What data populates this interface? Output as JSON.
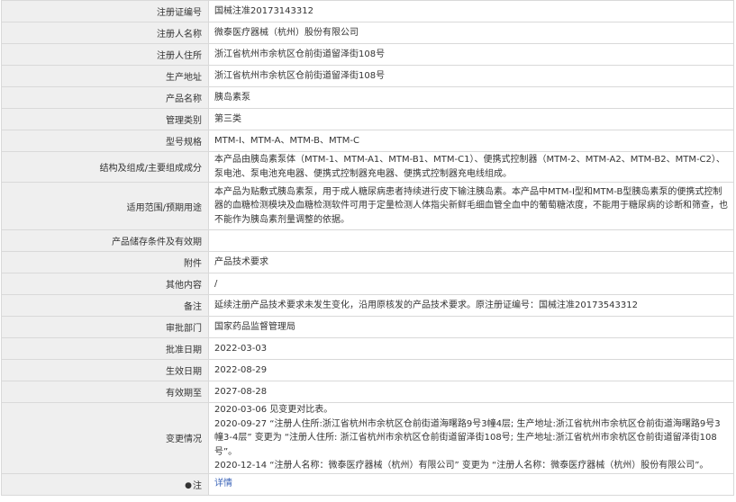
{
  "rows": {
    "registration_no": {
      "label": "注册证编号",
      "value": "国械注准20173143312"
    },
    "registrant_name": {
      "label": "注册人名称",
      "value": "微泰医疗器械（杭州）股份有限公司"
    },
    "registrant_address": {
      "label": "注册人住所",
      "value": "浙江省杭州市余杭区仓前街道留泽街108号"
    },
    "production_address": {
      "label": "生产地址",
      "value": "浙江省杭州市余杭区仓前街道留泽街108号"
    },
    "product_name": {
      "label": "产品名称",
      "value": "胰岛素泵"
    },
    "management_class": {
      "label": "管理类别",
      "value": "第三类"
    },
    "model_spec": {
      "label": "型号规格",
      "value": "MTM-I、MTM-A、MTM-B、MTM-C"
    },
    "structure": {
      "label": "结构及组成/主要组成成分",
      "value": "本产品由胰岛素泵体（MTM-1、MTM-A1、MTM-B1、MTM-C1）、便携式控制器（MTM-2、MTM-A2、MTM-B2、MTM-C2）、泵电池、泵电池充电器、便携式控制器充电器、便携式控制器充电线组成。"
    },
    "intended_use": {
      "label": "适用范围/预期用途",
      "value": "本产品为贴敷式胰岛素泵，用于成人糖尿病患者持续进行皮下输注胰岛素。本产品中MTM-I型和MTM-B型胰岛素泵的便携式控制器的血糖检测模块及血糖检测软件可用于定量检测人体指尖新鲜毛细血管全血中的葡萄糖浓度，不能用于糖尿病的诊断和筛查，也不能作为胰岛素剂量调整的依据。"
    },
    "storage": {
      "label": "产品储存条件及有效期",
      "value": ""
    },
    "attachment": {
      "label": "附件",
      "value": "产品技术要求"
    },
    "other_content": {
      "label": "其他内容",
      "value": "/"
    },
    "remarks": {
      "label": "备注",
      "value": "延续注册产品技术要求未发生变化，沿用原核发的产品技术要求。原注册证编号：国械注准20173543312"
    },
    "approval_dept": {
      "label": "审批部门",
      "value": "国家药品监督管理局"
    },
    "approval_date": {
      "label": "批准日期",
      "value": "2022-03-03"
    },
    "effective_date": {
      "label": "生效日期",
      "value": "2022-08-29"
    },
    "valid_until": {
      "label": "有效期至",
      "value": "2027-08-28"
    },
    "change_history": {
      "label": "变更情况",
      "entries": [
        "2020-03-06 见变更对比表。",
        "2020-09-27 “注册人住所:浙江省杭州市余杭区仓前街道海曙路9号3幢4层; 生产地址:浙江省杭州市余杭区仓前街道海曙路9号3幢3-4层” 变更为 “注册人住所: 浙江省杭州市余杭区仓前街道留泽街108号; 生产地址:浙江省杭州市余杭区仓前街道留泽街108号”。",
        "2020-12-14 “注册人名称：微泰医疗器械（杭州）有限公司” 变更为 “注册人名称：微泰医疗器械（杭州）股份有限公司”。"
      ]
    },
    "note": {
      "icon_glyph": "●",
      "label": "注",
      "link_text": "详情"
    }
  }
}
